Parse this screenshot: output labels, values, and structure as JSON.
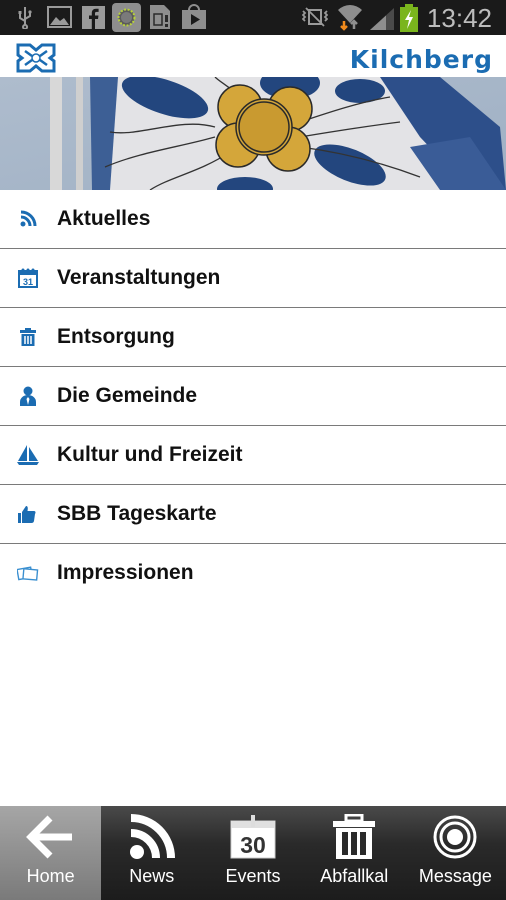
{
  "status_bar": {
    "time": "13:42",
    "left_icons": [
      "usb-icon",
      "gallery-icon",
      "facebook-icon",
      "sun-app-icon",
      "sim-card-icon",
      "play-store-icon"
    ],
    "right_icons": [
      "vibrate-mute-icon",
      "wifi-icon",
      "signal-icon",
      "battery-charging-icon"
    ]
  },
  "header": {
    "brand": "Kilchberg"
  },
  "menu": {
    "items": [
      {
        "label": "Aktuelles",
        "icon": "rss-icon"
      },
      {
        "label": "Veranstaltungen",
        "icon": "calendar-icon"
      },
      {
        "label": "Entsorgung",
        "icon": "trash-icon"
      },
      {
        "label": "Die Gemeinde",
        "icon": "person-icon"
      },
      {
        "label": "Kultur und Freizeit",
        "icon": "sailboat-icon"
      },
      {
        "label": "SBB Tageskarte",
        "icon": "thumbs-up-icon"
      },
      {
        "label": "Impressionen",
        "icon": "photos-icon"
      }
    ]
  },
  "tabbar": {
    "calendar_day": "30",
    "tabs": [
      {
        "label": "Home",
        "icon": "arrow-left-icon",
        "active": true
      },
      {
        "label": "News",
        "icon": "rss-icon"
      },
      {
        "label": "Events",
        "icon": "calendar-icon"
      },
      {
        "label": "Abfallkal",
        "icon": "trash-icon"
      },
      {
        "label": "Message",
        "icon": "target-icon"
      }
    ]
  },
  "colors": {
    "accent": "#1b6cb2",
    "statusbar": "#1a1a1a",
    "flag_gold": "#d4a63a",
    "flag_blue": "#23467e"
  }
}
